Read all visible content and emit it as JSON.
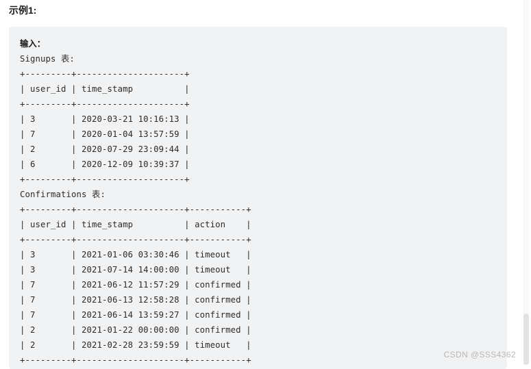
{
  "page": {
    "heading": "示例1:",
    "watermark": "CSDN @SSS4362"
  },
  "code_block": {
    "input_label": "输入：",
    "signups_label": "Signups 表:",
    "confirmations_label": "Confirmations 表:",
    "lines": [
      "输入：",
      "Signups 表:",
      "+---------+---------------------+",
      "| user_id | time_stamp          |",
      "+---------+---------------------+",
      "| 3       | 2020-03-21 10:16:13 |",
      "| 7       | 2020-01-04 13:57:59 |",
      "| 2       | 2020-07-29 23:09:44 |",
      "| 6       | 2020-12-09 10:39:37 |",
      "+---------+---------------------+",
      "Confirmations 表:",
      "+---------+---------------------+-----------+",
      "| user_id | time_stamp          | action    |",
      "+---------+---------------------+-----------+",
      "| 3       | 2021-01-06 03:30:46 | timeout   |",
      "| 3       | 2021-07-14 14:00:00 | timeout   |",
      "| 7       | 2021-06-12 11:57:29 | confirmed |",
      "| 7       | 2021-06-13 12:58:28 | confirmed |",
      "| 7       | 2021-06-14 13:59:27 | confirmed |",
      "| 2       | 2021-01-22 00:00:00 | confirmed |",
      "| 2       | 2021-02-28 23:59:59 | timeout   |",
      "+---------+---------------------+-----------+"
    ],
    "signups_table": {
      "columns": [
        "user_id",
        "time_stamp"
      ],
      "rows": [
        [
          "3",
          "2020-03-21 10:16:13"
        ],
        [
          "7",
          "2020-01-04 13:57:59"
        ],
        [
          "2",
          "2020-07-29 23:09:44"
        ],
        [
          "6",
          "2020-12-09 10:39:37"
        ]
      ]
    },
    "confirmations_table": {
      "columns": [
        "user_id",
        "time_stamp",
        "action"
      ],
      "rows": [
        [
          "3",
          "2021-01-06 03:30:46",
          "timeout"
        ],
        [
          "3",
          "2021-07-14 14:00:00",
          "timeout"
        ],
        [
          "7",
          "2021-06-12 11:57:29",
          "confirmed"
        ],
        [
          "7",
          "2021-06-13 12:58:28",
          "confirmed"
        ],
        [
          "7",
          "2021-06-14 13:59:27",
          "confirmed"
        ],
        [
          "2",
          "2021-01-22 00:00:00",
          "confirmed"
        ],
        [
          "2",
          "2021-02-28 23:59:59",
          "timeout"
        ]
      ]
    }
  },
  "colors": {
    "code_background": "#f1f2f3",
    "code_text": "#2b2b2b",
    "heading_text": "#1c1c1c",
    "watermark_text": "#b8b8b8",
    "scrollbar_thumb": "#e3e3e3"
  }
}
